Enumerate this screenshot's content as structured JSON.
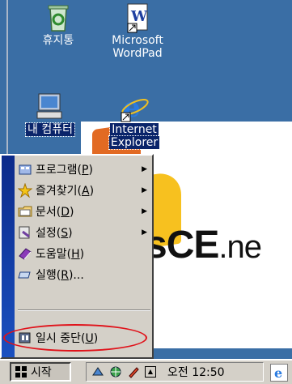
{
  "desktop": {
    "icons": [
      {
        "label": "휴지통"
      },
      {
        "label_line1": "Microsoft",
        "label_line2": "WordPad"
      },
      {
        "label": "내 컴퓨터"
      },
      {
        "label_line1": "Internet",
        "label_line2": "Explorer"
      }
    ],
    "wallpaper_text_main": "sCE",
    "wallpaper_text_suffix": ".ne"
  },
  "start_menu": {
    "items": [
      {
        "label": "프로그램(",
        "mnemonic": "P",
        "close": ")",
        "icon": "programs-folder-icon",
        "has_submenu": true
      },
      {
        "label": "즐겨찾기(",
        "mnemonic": "A",
        "close": ")",
        "icon": "favorites-star-icon",
        "has_submenu": true
      },
      {
        "label": "문서(",
        "mnemonic": "D",
        "close": ")",
        "icon": "documents-icon",
        "has_submenu": true
      },
      {
        "label": "설정(",
        "mnemonic": "S",
        "close": ")",
        "icon": "settings-icon",
        "has_submenu": true
      },
      {
        "label": "도움말(",
        "mnemonic": "H",
        "close": ")",
        "icon": "help-book-icon",
        "has_submenu": false
      },
      {
        "label": "실행(",
        "mnemonic": "R",
        "close": ")...",
        "icon": "run-icon",
        "has_submenu": false
      },
      {
        "label": "일시 중단(",
        "mnemonic": "U",
        "close": ")",
        "icon": "suspend-icon",
        "has_submenu": false
      }
    ],
    "highlight_color": "#e0121a"
  },
  "taskbar": {
    "start_label": "시작",
    "clock": "오전 12:50"
  }
}
